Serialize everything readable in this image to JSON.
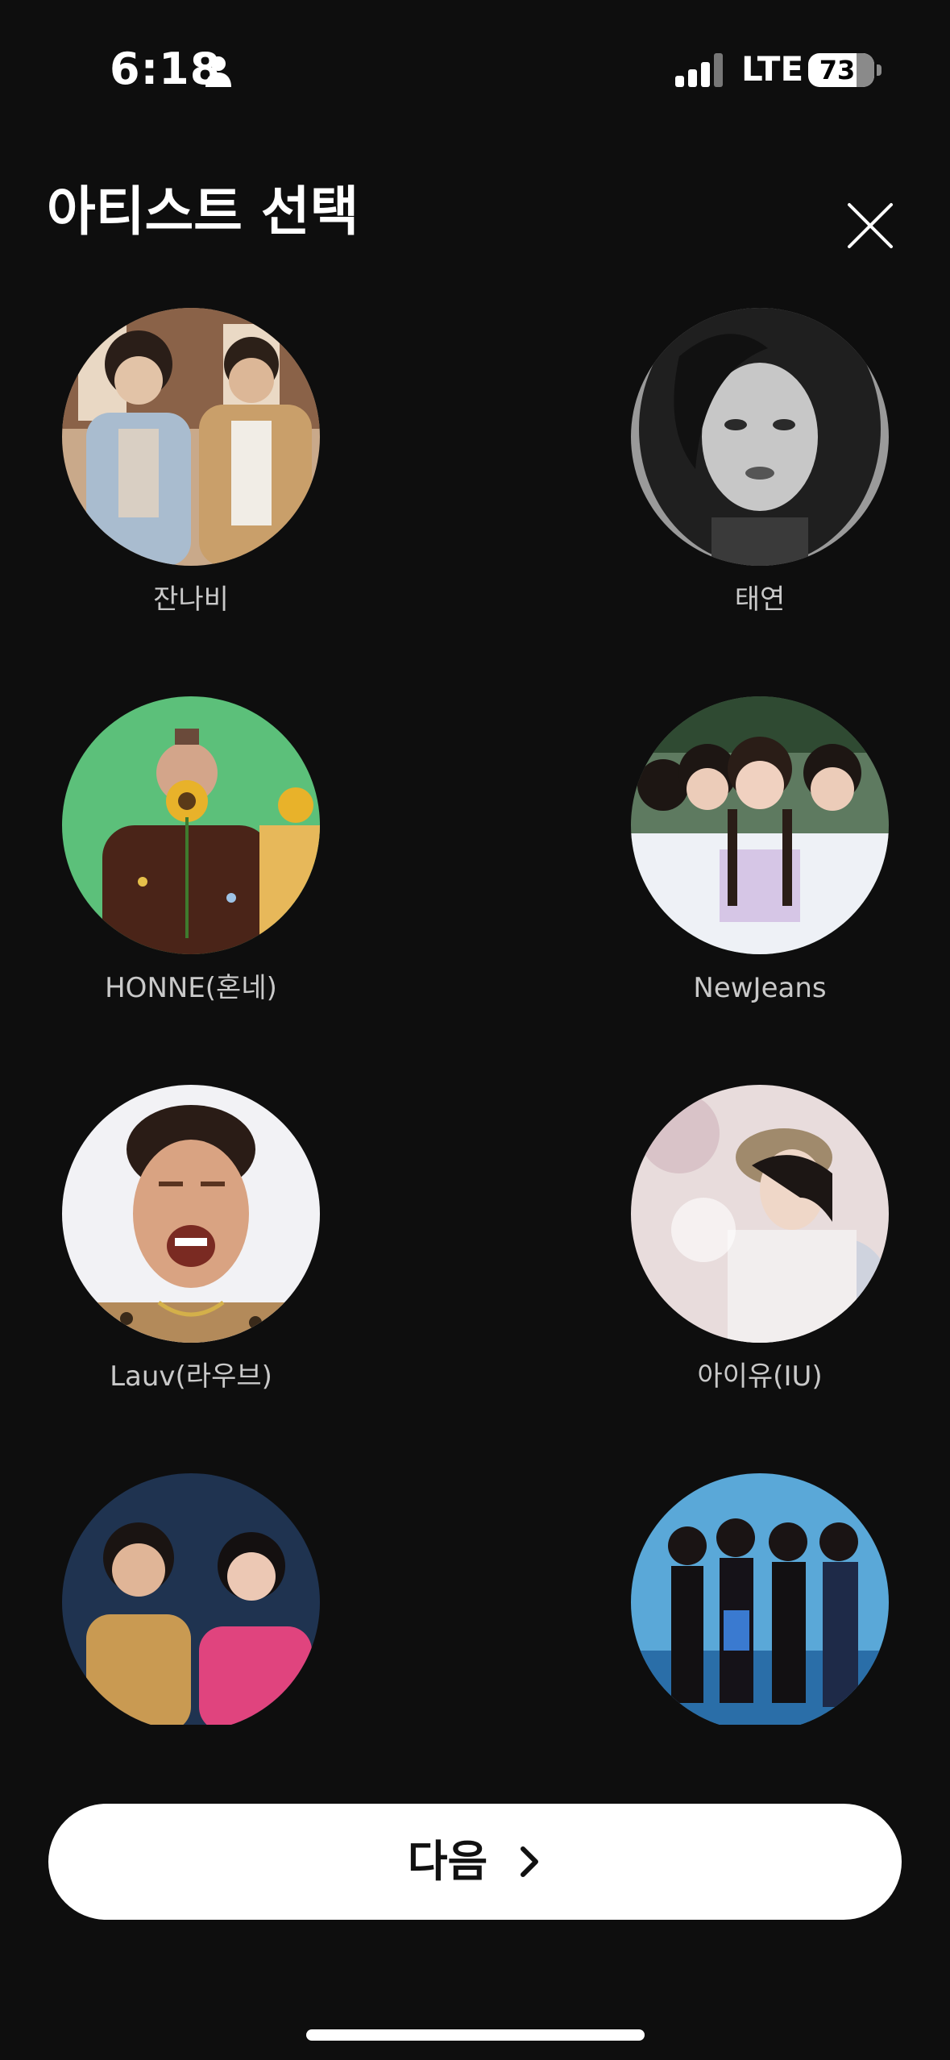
{
  "status_bar": {
    "time": "6:18",
    "network": "LTE",
    "battery_level": "73",
    "icons": [
      "person-icon",
      "signal-icon",
      "battery-icon"
    ]
  },
  "header": {
    "title": "아티스트 선택",
    "close_icon": "close-icon"
  },
  "artists": [
    {
      "name": "잔나비"
    },
    {
      "name": "태연"
    },
    {
      "name": "HONNE(혼네)"
    },
    {
      "name": "NewJeans"
    },
    {
      "name": "Lauv(라우브)"
    },
    {
      "name": "아이유(IU)"
    },
    {
      "name": ""
    },
    {
      "name": ""
    }
  ],
  "footer": {
    "next_label": "다음",
    "next_icon": "chevron-right-icon"
  },
  "colors": {
    "background": "#0e0e0e",
    "button": "#ffffff",
    "artist_label": "#c9c9c9"
  }
}
